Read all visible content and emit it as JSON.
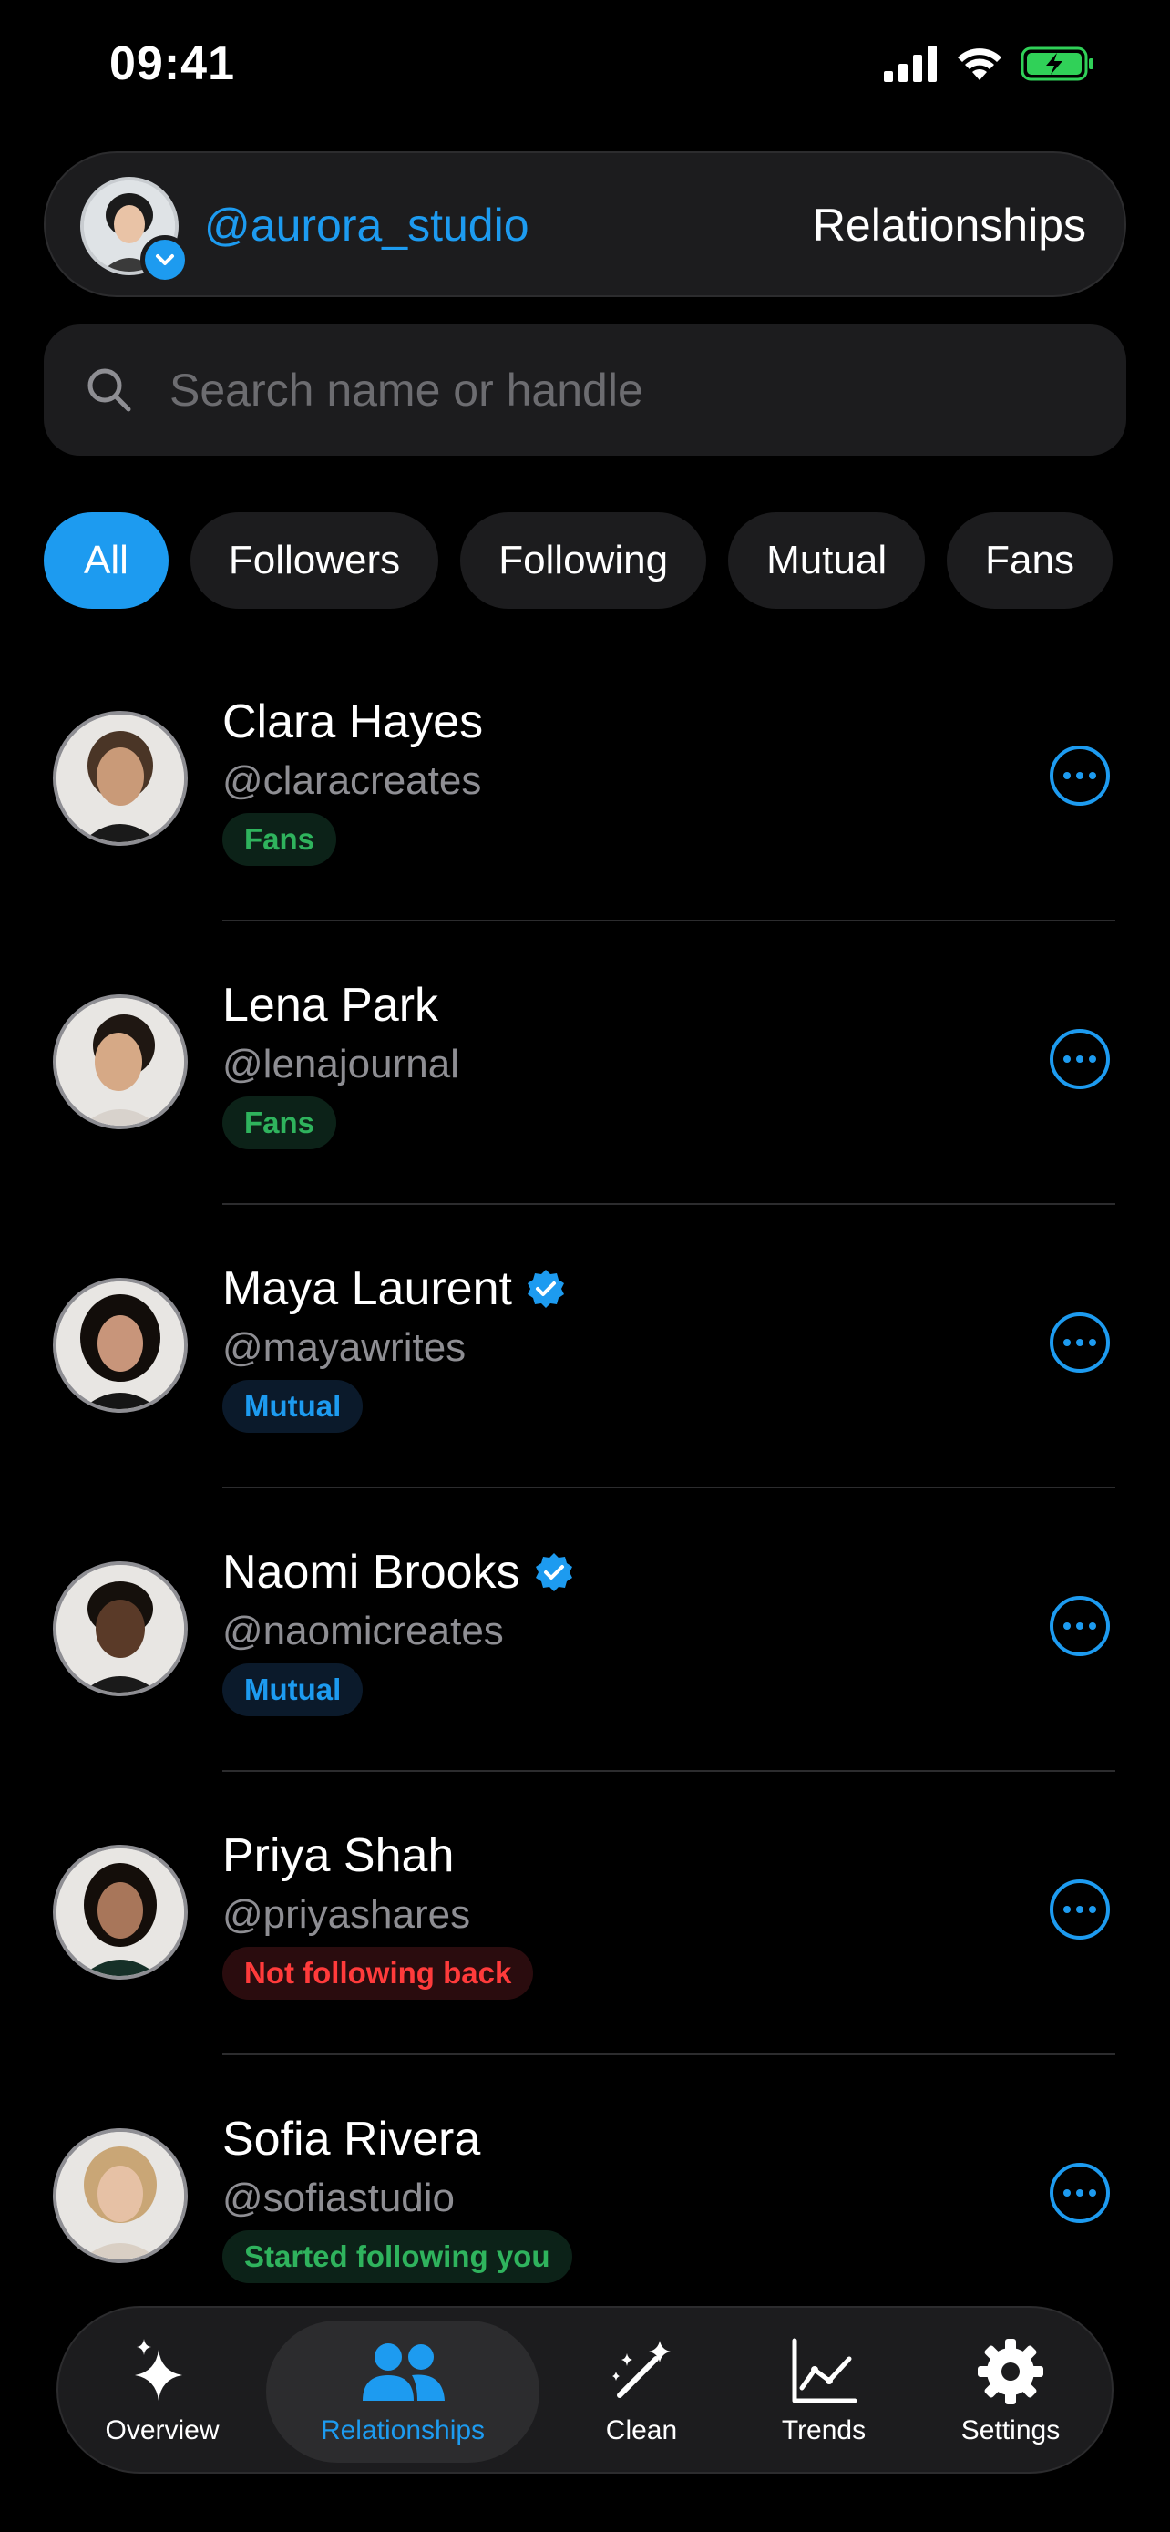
{
  "status_bar": {
    "time": "09:41"
  },
  "account": {
    "handle": "@aurora_studio",
    "section_title": "Relationships"
  },
  "search": {
    "placeholder": "Search name or handle",
    "value": ""
  },
  "filters": [
    {
      "label": "All",
      "active": true
    },
    {
      "label": "Followers",
      "active": false
    },
    {
      "label": "Following",
      "active": false
    },
    {
      "label": "Mutual",
      "active": false
    },
    {
      "label": "Fans",
      "active": false
    }
  ],
  "people": [
    {
      "name": "Clara Hayes",
      "handle": "@claracreates",
      "tag": "Fans",
      "tag_type": "fans",
      "verified": false
    },
    {
      "name": "Lena Park",
      "handle": "@lenajournal",
      "tag": "Fans",
      "tag_type": "fans",
      "verified": false
    },
    {
      "name": "Maya Laurent",
      "handle": "@mayawrites",
      "tag": "Mutual",
      "tag_type": "mutual",
      "verified": true
    },
    {
      "name": "Naomi Brooks",
      "handle": "@naomicreates",
      "tag": "Mutual",
      "tag_type": "mutual",
      "verified": true
    },
    {
      "name": "Priya Shah",
      "handle": "@priyashares",
      "tag": "Not following back",
      "tag_type": "unfollow",
      "verified": false
    },
    {
      "name": "Sofia Rivera",
      "handle": "@sofiastudio",
      "tag": "Started following you",
      "tag_type": "fans",
      "verified": false
    }
  ],
  "nav": [
    {
      "label": "Overview",
      "icon": "sparkles-icon",
      "active": false
    },
    {
      "label": "Relationships",
      "icon": "people-icon",
      "active": true
    },
    {
      "label": "Clean",
      "icon": "magic-wand-icon",
      "active": false
    },
    {
      "label": "Trends",
      "icon": "line-chart-icon",
      "active": false
    },
    {
      "label": "Settings",
      "icon": "gear-icon",
      "active": false
    }
  ],
  "colors": {
    "accent": "#1d9bf0",
    "fans": "#2fb35d",
    "unfollow": "#ff3b3b",
    "surface": "#1c1c1e"
  }
}
